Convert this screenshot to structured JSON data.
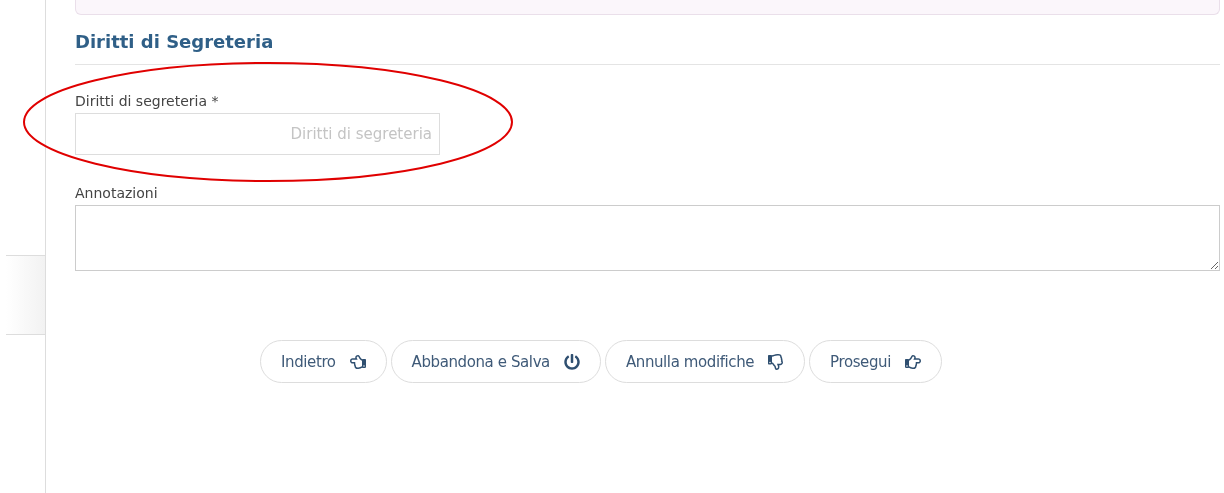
{
  "section": {
    "title": "Diritti di Segreteria"
  },
  "fields": [
    {
      "kind": "input",
      "label": "Diritti di segreteria *",
      "placeholder": "Diritti di segreteria",
      "highlighted": true
    },
    {
      "kind": "textarea",
      "label": "Annotazioni"
    }
  ],
  "buttons": [
    {
      "label": "Indietro"
    },
    {
      "label": "Abbandona e Salva"
    },
    {
      "label": "Annulla modifiche"
    },
    {
      "label": "Prosegui"
    }
  ]
}
